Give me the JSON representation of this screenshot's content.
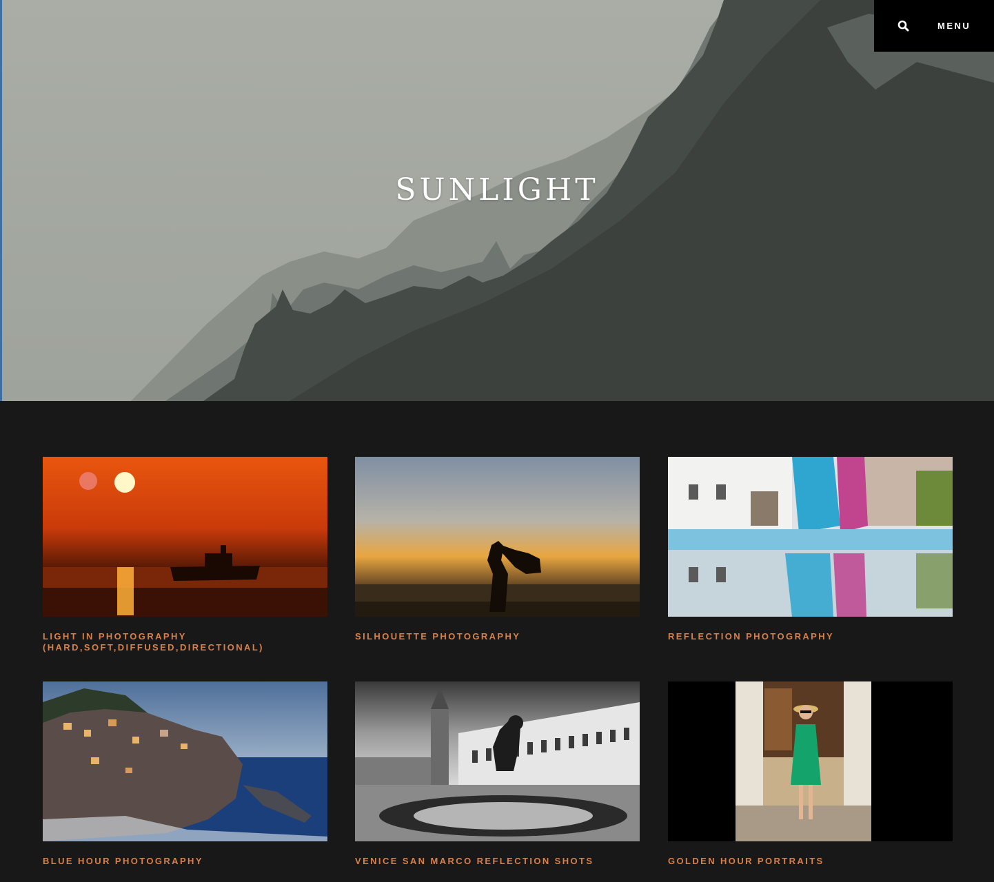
{
  "header": {
    "search_icon": "search-icon",
    "menu_label": "MENU"
  },
  "hero": {
    "title": "SUNLIGHT"
  },
  "colors": {
    "background": "#181818",
    "accent": "#d8804a",
    "topbar": "#000000"
  },
  "posts": [
    {
      "title": "LIGHT IN PHOTOGRAPHY (HARD,SOFT,DIFFUSED,DIRECTIONAL)"
    },
    {
      "title": "SILHOUETTE PHOTOGRAPHY"
    },
    {
      "title": "REFLECTION PHOTOGRAPHY"
    },
    {
      "title": "BLUE HOUR PHOTOGRAPHY"
    },
    {
      "title": "VENICE SAN MARCO REFLECTION SHOTS"
    },
    {
      "title": "GOLDEN HOUR PORTRAITS"
    }
  ]
}
